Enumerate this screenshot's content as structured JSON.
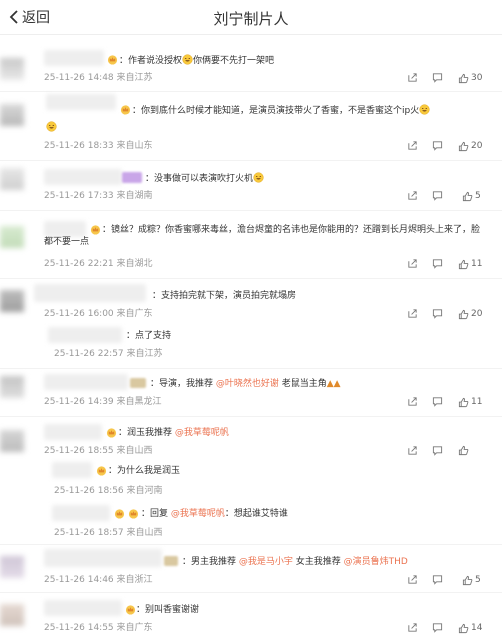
{
  "header": {
    "back_label": "返回",
    "title": "刘宁制片人"
  },
  "comments": [
    {
      "text": "：作者说没授权",
      "text2": "你俩要不先打一架吧",
      "date": "25-11-26 14:48",
      "loc": "来自江苏",
      "likes": "30"
    },
    {
      "text": "：你到底什么时候才能知道，是演员演技带火了香蜜，不是香蜜这个ip火",
      "date": "25-11-26 18:33",
      "loc": "来自山东",
      "likes": "20"
    },
    {
      "text": "：没事做可以表演吹打火机",
      "date": "25-11-26 17:33",
      "loc": "来自湖南",
      "likes": "5"
    },
    {
      "text": "：镜丝？成粽？你香蜜哪来毒丝，澹台烬童的名讳也是你能用的？还蹭到长月烬明头上来了，脸都不要一点",
      "date": "25-11-26 22:21",
      "loc": "来自湖北",
      "likes": "11"
    },
    {
      "text": "：支持拍完就下架，演员拍完就塌房",
      "date": "25-11-26 16:00",
      "loc": "来自广东",
      "likes": "20"
    },
    {
      "text": "：点了支持",
      "date": "25-11-26 22:57",
      "loc": "来自江苏"
    },
    {
      "text_pre": "：导演，我推荐 ",
      "mention": "@叶晓然也好谢",
      "text_post": " 老鼠当主角",
      "date": "25-11-26 14:39",
      "loc": "来自黑龙江",
      "likes": "11"
    },
    {
      "text_pre": "：润玉我推荐 ",
      "mention": "@我草莓呢帆",
      "date": "25-11-26 18:55",
      "loc": "来自山西"
    },
    {
      "text": "：为什么我是润玉",
      "date": "25-11-26 18:56",
      "loc": "来自河南"
    },
    {
      "text_pre": "：回复 ",
      "mention": "@我草莓呢帆",
      "text_post": "：想起谁艾特谁",
      "date": "25-11-26 18:57",
      "loc": "来自山西"
    },
    {
      "text_pre": "：男主我推荐 ",
      "mention": "@我是马小宇",
      "text_mid": " 女主我推荐 ",
      "mention2": "@演员鲁炜THD",
      "date": "25-11-26 14:46",
      "loc": "来自浙江",
      "likes": "5"
    },
    {
      "text": "：别叫香蜜谢谢",
      "date": "25-11-26 14:55",
      "loc": "来自广东",
      "likes": "14"
    }
  ],
  "icons": {
    "share": "share-icon",
    "comment": "comment-icon",
    "like": "like-icon",
    "crown": "crown-badge-icon",
    "emoji": "laughing-emoji-icon"
  },
  "colors": {
    "mention": "#eb7350",
    "meta": "#999999",
    "text": "#333333"
  }
}
